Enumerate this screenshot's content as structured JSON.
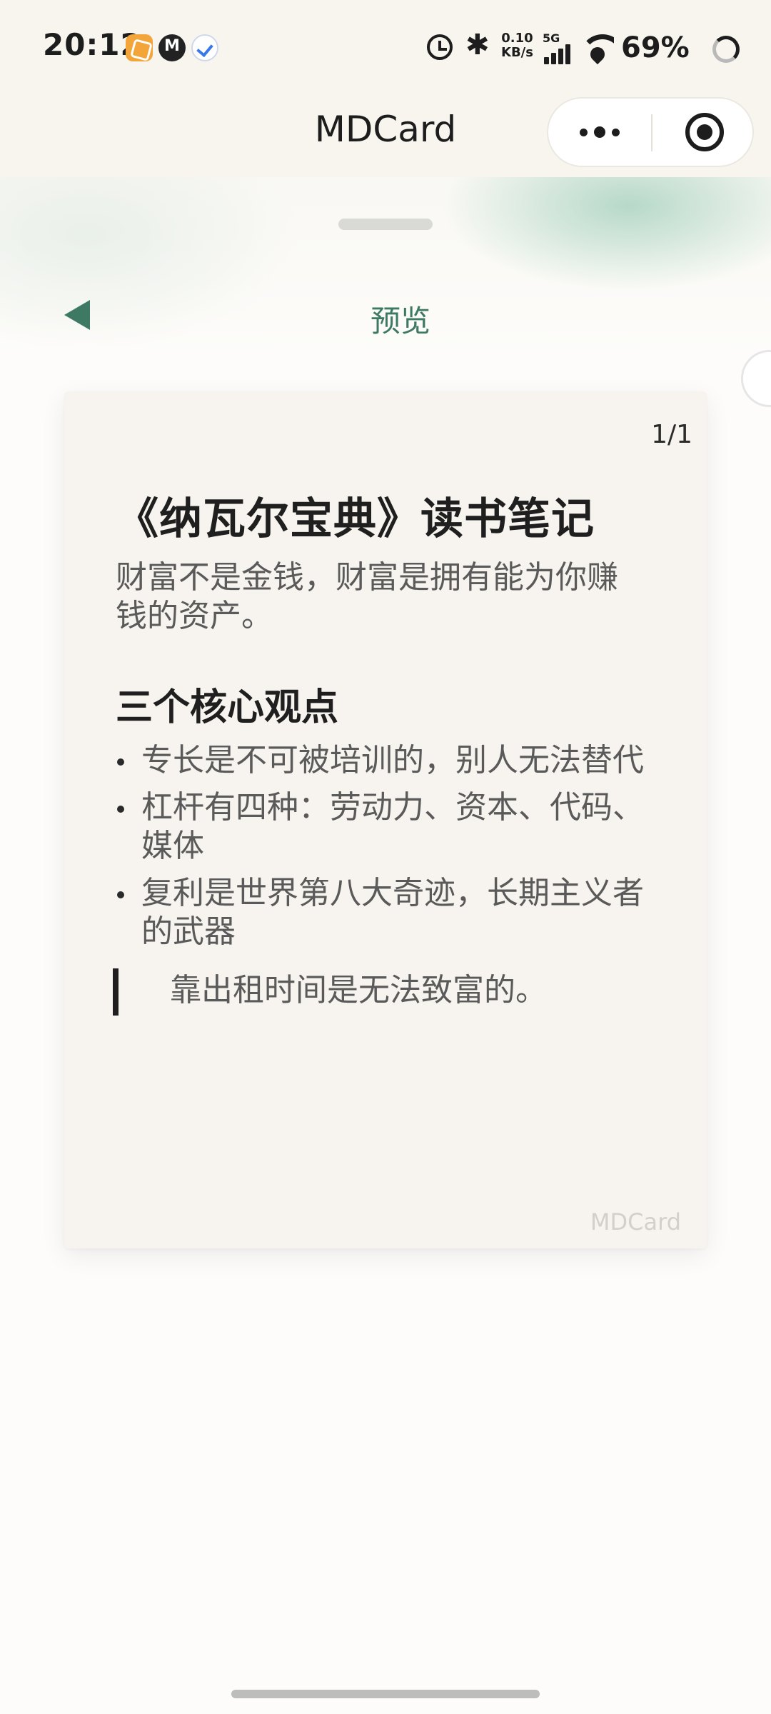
{
  "status_bar": {
    "time": "20:12",
    "speed_value": "0.10",
    "speed_unit": "KB/s",
    "network_type": "5G",
    "battery_percent": "69%",
    "bluetooth_glyph": "✱"
  },
  "nav": {
    "title": "MDCard"
  },
  "header": {
    "title": "预览"
  },
  "card": {
    "page_indicator": "1/1",
    "title": "《纳瓦尔宝典》读书笔记",
    "subtitle": "财富不是金钱，财富是拥有能为你赚钱的资产。",
    "section_heading": "三个核心观点",
    "points": [
      "专长是不可被培训的，别人无法替代",
      "杠杆有四种：劳动力、资本、代码、媒体",
      "复利是世界第八大奇迹，长期主义者的武器"
    ],
    "quote": "靠出租时间是无法致富的。",
    "watermark": "MDCard"
  },
  "colors": {
    "accent_green": "#3e7a63",
    "card_background": "#f7f4ef",
    "status_bar_background": "#f8f5ee"
  },
  "icons": {
    "back": "triangle-left-icon",
    "more": "more-dots-icon",
    "close": "target-close-icon"
  }
}
